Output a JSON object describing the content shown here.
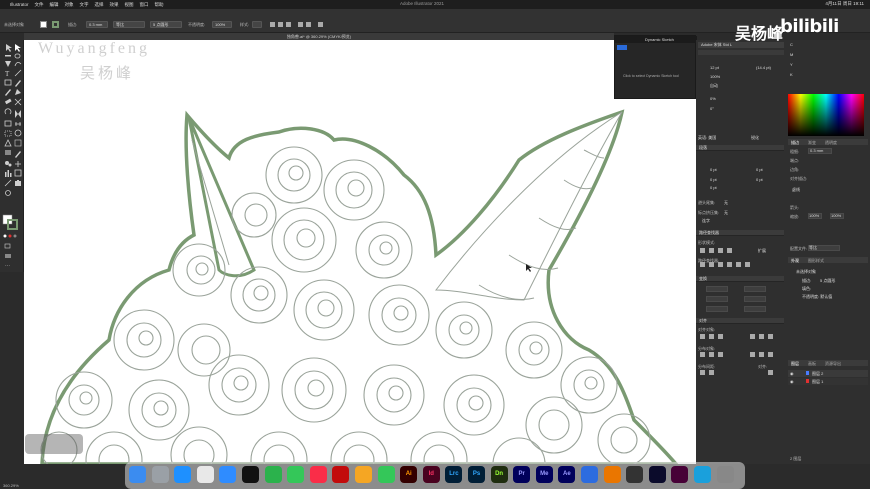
{
  "menubar": {
    "apple": "",
    "items": [
      "Illustrator",
      "文件",
      "编辑",
      "对象",
      "文字",
      "选择",
      "效果",
      "视图",
      "窗口",
      "帮助"
    ],
    "center_title": "Adobe Illustrator 2021",
    "clock": "4月11日 周日 19:11"
  },
  "controlbar": {
    "title_label": "未选择对象",
    "stroke_label": "描边:",
    "stroke_value": "0.3 mm",
    "profile_value": "等比",
    "brush_value": "5 点圆形",
    "opacity_label": "不透明度:",
    "opacity_value": "100%",
    "style_label": "样式:"
  },
  "document": {
    "tab_title": "独角兽.ai* @ 360.29% (CMYK/预览)"
  },
  "watermark": {
    "en": "Wuyangfeng",
    "cn": "吴杨峰"
  },
  "brand": {
    "name": "吴杨峰",
    "site": "bilibili"
  },
  "dynamic_sketch": {
    "tab_label": "Dynamic Sketch",
    "message": "Click to select Dynamic Sketch tool"
  },
  "character_panel": {
    "font_name": "Adobe 宋体 Std L",
    "size": "12 pt",
    "leading": "(14.4 pt)",
    "tracking": "100%",
    "kerning": "自动",
    "baseline": "0%",
    "rotation": "0°",
    "lang": "英语: 美国",
    "sharp": "锐化"
  },
  "paragraph_panel": {
    "title": "段落",
    "indent_left": "0 pt",
    "indent_right": "0 pt",
    "first_line": "0 pt",
    "space_before": "0 pt",
    "space_after": "0 pt",
    "hyphenate": "连字",
    "kinsoku": "避头尾集:",
    "kinsoku_value": "无",
    "mojikumi": "标点挤压集:",
    "mojikumi_value": "无"
  },
  "pathfinder_panel": {
    "title": "路径查找器",
    "shape_modes": "形状模式:",
    "pathfinders": "路径查找器:",
    "expand": "扩展"
  },
  "transform_panel": {
    "title": "变换"
  },
  "align_panel": {
    "title": "对齐",
    "align_objects": "对齐对象:",
    "distribute_objects": "分布对象:",
    "distribute_spacing": "分布间距:",
    "align_to": "对齐:"
  },
  "stroke_panel": {
    "tabs": [
      "描边",
      "渐变",
      "透明度"
    ],
    "weight_label": "粗细:",
    "weight_value": "0.3 mm",
    "cap_label": "端点:",
    "corner_label": "边角:",
    "align_label": "对齐描边:",
    "dashed": "虚线",
    "arrow_label": "箭头:",
    "scale_label": "缩放:",
    "scale_value": "100%",
    "profile_label": "配置文件:",
    "profile_value": "等比"
  },
  "appearance_panel": {
    "tabs": [
      "外观",
      "图形样式"
    ],
    "title": "未选择对象",
    "stroke_row": "描边:",
    "stroke_value": "5 点圆形",
    "fill_row": "填色:",
    "opacity_row": "不透明度: 默认值"
  },
  "layers_panel": {
    "tabs": [
      "图层",
      "画板",
      "资源导出"
    ],
    "layers": [
      {
        "name": "图层 2",
        "color": "#4a7cff"
      },
      {
        "name": "图层 1",
        "color": "#e03030"
      }
    ],
    "footer": "2 图层"
  },
  "color_panel": {
    "tabs": [
      "颜色",
      "色板",
      "颜色参考"
    ],
    "labels": [
      "C",
      "M",
      "Y",
      "K"
    ]
  },
  "statusbar": {
    "zoom": "360.29%"
  },
  "dock": {
    "icons": [
      "finder-icon",
      "launchpad-icon",
      "appstore-icon",
      "chrome-icon",
      "safari-icon",
      "qq-icon",
      "wechat-icon",
      "messages-icon",
      "music-icon",
      "netease-icon",
      "photos-icon",
      "facetime-icon",
      "ai-icon",
      "id-icon",
      "lrc-icon",
      "ps-icon",
      "dn-icon",
      "pr-icon",
      "me-icon",
      "ae-icon",
      "vpn-icon",
      "blender-icon",
      "zbrush-icon",
      "c4d-icon",
      "xd-icon",
      "qt-icon",
      "trash-icon"
    ],
    "labels": {
      "ai": "Ai",
      "id": "Id",
      "lrc": "Lrc",
      "ps": "Ps",
      "dn": "Dn",
      "pr": "Pr",
      "me": "Me",
      "ae": "Ae"
    }
  },
  "colors": {
    "outline_green": "#7a9a72",
    "line_gray": "#9aa39a",
    "ui_bg": "#2f2f2f"
  }
}
